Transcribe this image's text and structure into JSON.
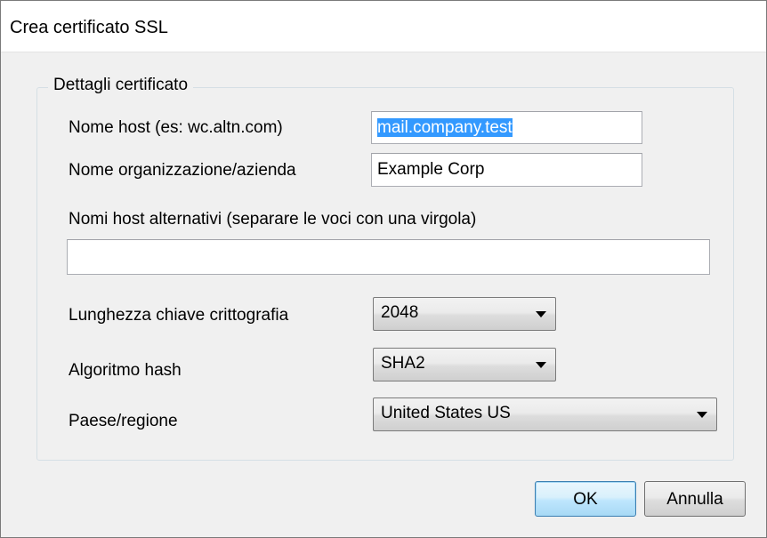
{
  "window": {
    "title": "Crea certificato SSL"
  },
  "group": {
    "legend": "Dettagli certificato"
  },
  "fields": {
    "host_name_label": "Nome host (es: wc.altn.com)",
    "host_name_value": "mail.company.test",
    "org_label": "Nome organizzazione/azienda",
    "org_value": "Example Corp",
    "alt_hosts_label": "Nomi host alternativi (separare le voci con una virgola)",
    "alt_hosts_value": "",
    "key_length_label": "Lunghezza chiave crittografia",
    "key_length_value": "2048",
    "hash_label": "Algoritmo hash",
    "hash_value": "SHA2",
    "country_label": "Paese/regione",
    "country_value": "United States US"
  },
  "buttons": {
    "ok_label": "OK",
    "cancel_label": "Annulla"
  },
  "icons": {
    "dropdown": "chevron-down-icon"
  }
}
